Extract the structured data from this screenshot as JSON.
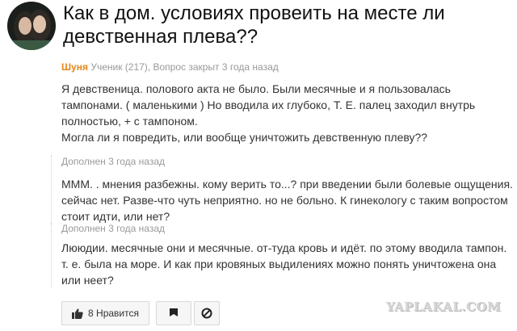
{
  "question": {
    "title": "Как в дом. условиях провеить на месте ли девственная плева??",
    "author": "Шуня",
    "author_meta": "Ученик (217), Вопрос закрыт 3 года назад",
    "body_lines": [
      "Я девственица. полового акта не было. Были месячные и я пользовалась",
      "тампонами. ( маленькими ) Но вводила их глубоко, Т. Е. палец заходил внутрь",
      "полностью, + с тампоном.",
      "Могла ли я повредить, или вообще уничтожить девственную плеву??"
    ]
  },
  "additions": [
    {
      "header": "Дополнен 3 года назад",
      "lines": [
        "МММ. . мнения разбежны. кому верить то...? при введении были болевые ощущения.",
        "сейчас нет. Разве-что чуть неприятно. но не больно. К гинекологу с таким вопростом",
        "стоит идти, или нет?"
      ]
    },
    {
      "header": "Дополнен 3 года назад",
      "lines": [
        "Лююдии. месячные они и месячные. от-туда кровь и идёт. по этому вводила тампон.",
        "т. е. была на море. И как при кровяных выдилениях можно понять уничтожена она",
        "или неет?"
      ]
    }
  ],
  "actions": {
    "like_count": "8",
    "like_label": "Нравится"
  },
  "watermark": "YAPLAKAL.COM",
  "icons": {
    "like": "thumbs-up-icon",
    "flag": "flag-icon",
    "block": "block-icon"
  },
  "colors": {
    "author": "#e4851b",
    "meta": "#999999",
    "title": "#111111"
  }
}
